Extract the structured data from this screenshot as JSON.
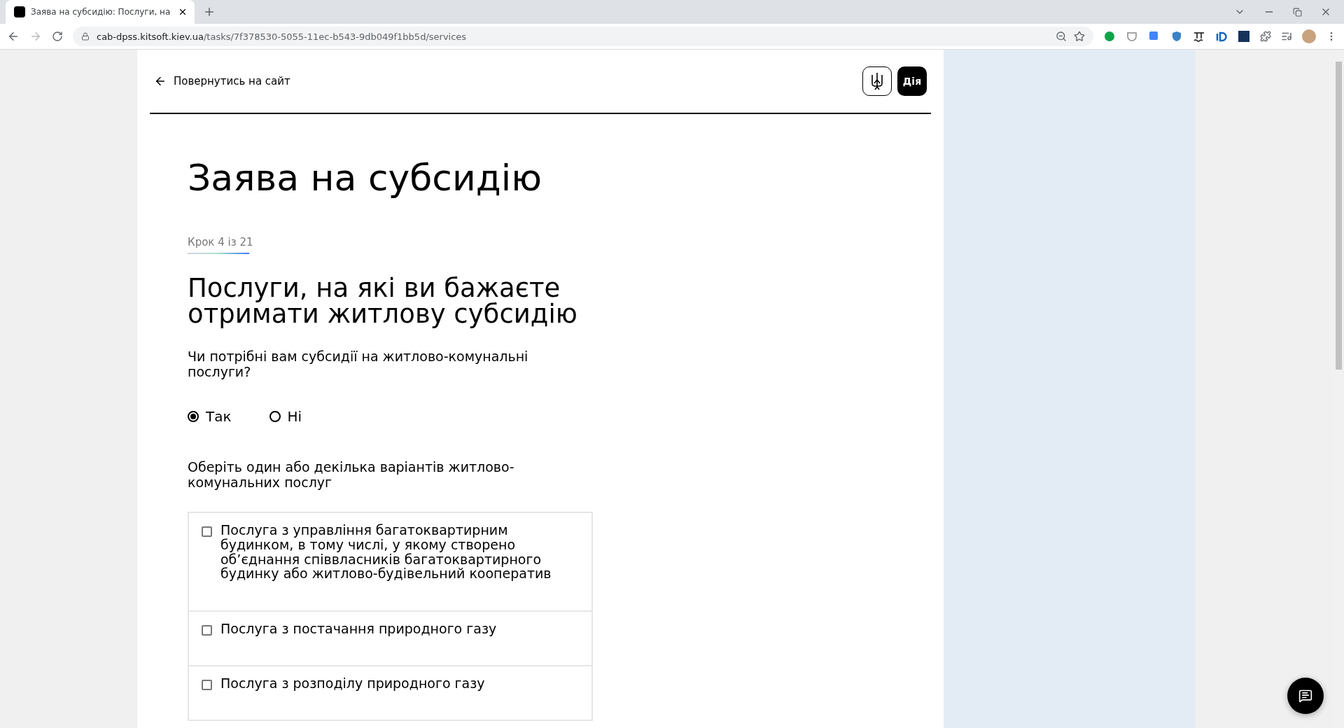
{
  "browser": {
    "tab": {
      "title": "Заява на субсидію: Послуги, на"
    },
    "url": {
      "host": "cab-dpss.kitsoft.kiev.ua",
      "path": "/tasks/7f378530-5055-11ec-b543-9db049f1bb5d/services"
    }
  },
  "header": {
    "back_link": "Повернутись на сайт",
    "logo_text": "Дія"
  },
  "title": "Заява на субсидію",
  "step": {
    "label": "Крок 4 із 21"
  },
  "section_title": "Послуги, на які ви бажаєте отримати житлову субсидію",
  "question": "Чи потрібні вам субсидії на житлово-комунальні послуги?",
  "options": [
    {
      "label": "Так",
      "selected": true
    },
    {
      "label": "Ні",
      "selected": false
    }
  ],
  "services_prompt": "Оберіть один або декілька варіантів житлово-комунальних послуг",
  "services": [
    {
      "label": "Послуга з управління багатоквартирним будинком, в тому числі, у якому створено об’єднання співвласників багатоквартирного будинку або житлово-будівельний кооператив",
      "checked": false
    },
    {
      "label": "Послуга з постачання природного газу",
      "checked": false
    },
    {
      "label": "Послуга з розподілу природного газу",
      "checked": false
    }
  ]
}
